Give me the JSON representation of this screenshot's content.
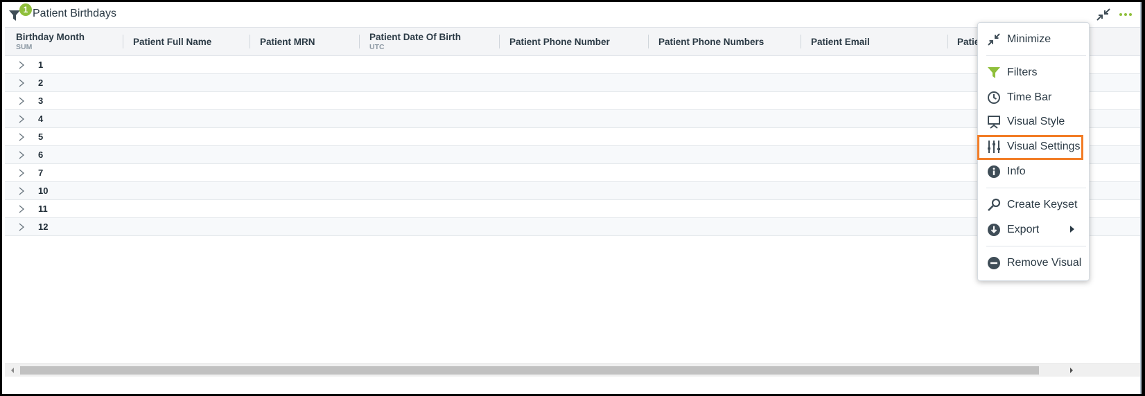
{
  "header": {
    "title": "Patient Birthdays",
    "filter_badge": "1"
  },
  "table": {
    "columns": [
      {
        "label": "Birthday Month",
        "sub": "SUM"
      },
      {
        "label": "Patient Full Name",
        "sub": ""
      },
      {
        "label": "Patient MRN",
        "sub": ""
      },
      {
        "label": "Patient Date Of Birth",
        "sub": "UTC"
      },
      {
        "label": "Patient Phone Number",
        "sub": ""
      },
      {
        "label": "Patient Phone Numbers",
        "sub": ""
      },
      {
        "label": "Patient Email",
        "sub": ""
      },
      {
        "label": "Patie",
        "sub": ""
      }
    ],
    "rows": [
      "1",
      "2",
      "3",
      "4",
      "5",
      "6",
      "7",
      "10",
      "11",
      "12"
    ]
  },
  "menu": {
    "items": [
      {
        "label": "Minimize",
        "icon": "minimize-icon"
      },
      {
        "label": "Filters",
        "icon": "filter-icon"
      },
      {
        "label": "Time Bar",
        "icon": "clock-icon"
      },
      {
        "label": "Visual Style",
        "icon": "easel-icon"
      },
      {
        "label": "Visual Settings",
        "icon": "sliders-icon"
      },
      {
        "label": "Info",
        "icon": "info-icon"
      },
      {
        "label": "Create Keyset",
        "icon": "key-icon"
      },
      {
        "label": "Export",
        "icon": "download-icon"
      },
      {
        "label": "Remove Visual",
        "icon": "remove-icon"
      }
    ]
  },
  "colors": {
    "accent_green": "#8fbf3b",
    "highlight_orange": "#f27d26",
    "text_dark": "#2b3a45"
  }
}
